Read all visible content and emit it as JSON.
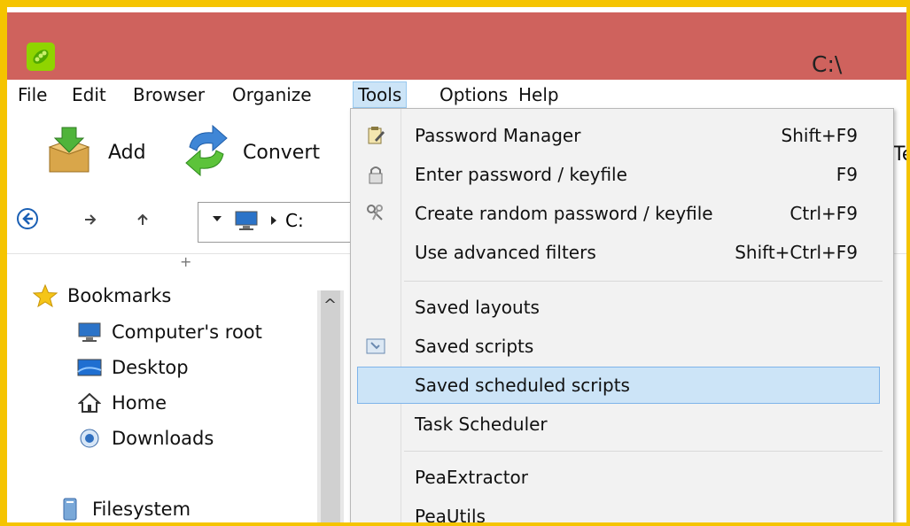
{
  "window": {
    "title": "C:\\"
  },
  "menubar": [
    "File",
    "Edit",
    "Browser",
    "Organize",
    "Tools",
    "Options",
    "Help"
  ],
  "toolbar": {
    "add_label": "Add",
    "convert_label": "Convert",
    "cut_text": "Te"
  },
  "address": {
    "path": "C:"
  },
  "sidebar": {
    "plus": "+",
    "scroll_up": "^",
    "bookmarks_label": "Bookmarks",
    "items": [
      {
        "label": "Computer's root",
        "icon": "monitor-icon"
      },
      {
        "label": "Desktop",
        "icon": "desktop-icon"
      },
      {
        "label": "Home",
        "icon": "home-icon"
      },
      {
        "label": "Downloads",
        "icon": "downloads-icon"
      }
    ],
    "filesystem_label": "Filesystem"
  },
  "tools_menu": {
    "items": [
      {
        "label": "Password Manager",
        "shortcut": "Shift+F9",
        "icon": "notepad-icon"
      },
      {
        "label": "Enter password / keyfile",
        "shortcut": "F9",
        "icon": "lock-icon"
      },
      {
        "label": "Create random password / keyfile",
        "shortcut": "Ctrl+F9",
        "icon": "keys-icon"
      },
      {
        "label": "Use advanced filters",
        "shortcut": "Shift+Ctrl+F9"
      },
      {
        "label": "Saved layouts"
      },
      {
        "label": "Saved scripts",
        "icon": "script-icon"
      },
      {
        "label": "Saved scheduled scripts",
        "highlighted": true
      },
      {
        "label": "Task Scheduler"
      },
      {
        "label": "PeaExtractor"
      },
      {
        "label": "PeaUtils"
      }
    ]
  },
  "colors": {
    "titlebar": "#cf625d",
    "border": "#f5c400",
    "highlight": "#cce4f7"
  }
}
